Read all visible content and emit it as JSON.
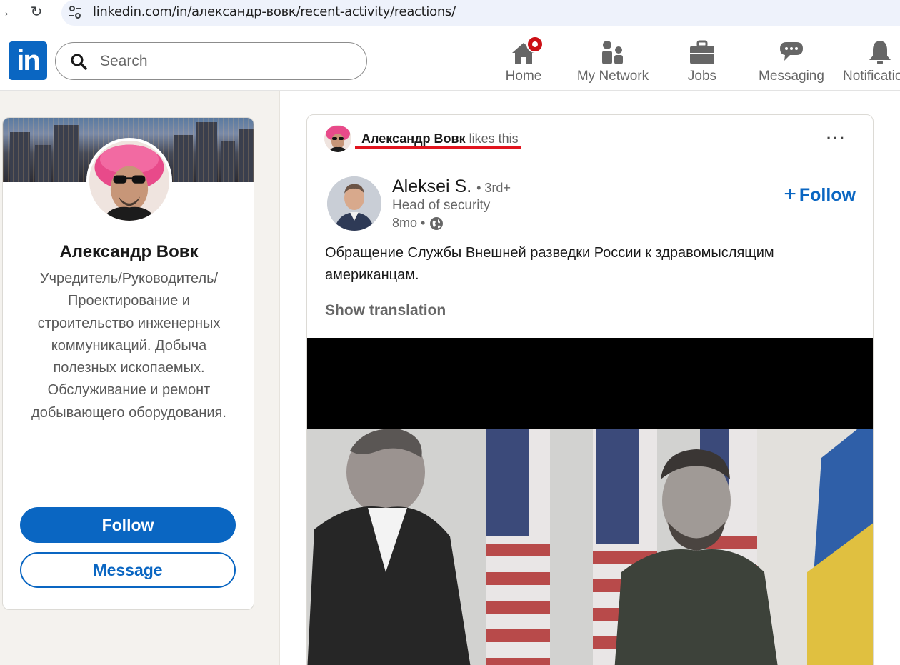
{
  "browser": {
    "url": "linkedin.com/in/александр-вовк/recent-activity/reactions/"
  },
  "nav": {
    "logo": "in",
    "search_placeholder": "Search",
    "items": [
      {
        "label": "Home",
        "icon": "home-icon"
      },
      {
        "label": "My Network",
        "icon": "network-icon"
      },
      {
        "label": "Jobs",
        "icon": "briefcase-icon"
      },
      {
        "label": "Messaging",
        "icon": "chat-icon"
      },
      {
        "label": "Notificatio",
        "icon": "bell-icon"
      }
    ]
  },
  "profile": {
    "name": "Александр Вовк",
    "headline": "Учредитель/Руководитель/ Проектирование и строительство инженерных коммуникаций. Добыча полезных ископаемых. Обслуживание и ремонт добывающего оборудования.",
    "follow_label": "Follow",
    "message_label": "Message"
  },
  "post": {
    "liker_name": "Александр Вовк",
    "liker_action": "likes this",
    "author_name": "Aleksei S.",
    "author_degree": "• 3rd+",
    "author_title": "Head of security",
    "posted": "8mo •",
    "follow_label": "Follow",
    "text": "Обращение Службы Внешней разведки России к здравомыслящим американцам.",
    "translate_label": "Show translation"
  },
  "colors": {
    "brand": "#0a66c2",
    "badge": "#cc1016",
    "highlight_underline": "#e1141e"
  }
}
